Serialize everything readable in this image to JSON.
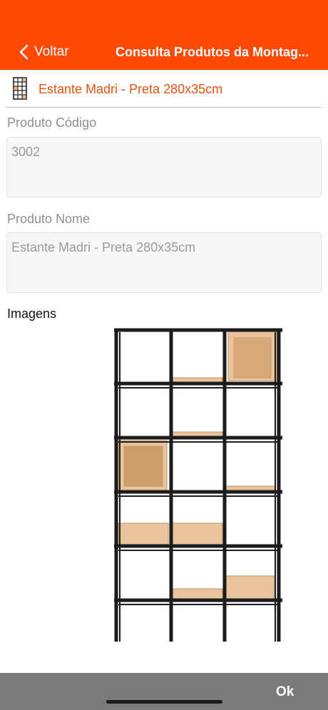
{
  "navbar": {
    "back_label": "Voltar",
    "title": "Consulta Produtos da Montag...",
    "color": "#fe4a05"
  },
  "product": {
    "icon": "shelf-icon",
    "name": "Estante Madri - Preta 280x35cm"
  },
  "fields": {
    "codigo": {
      "label": "Produto Código",
      "value": "3002"
    },
    "nome": {
      "label": "Produto Nome",
      "value": "Estante Madri - Preta 280x35cm"
    }
  },
  "images": {
    "label": "Imagens"
  },
  "footer": {
    "ok_label": "Ok"
  }
}
